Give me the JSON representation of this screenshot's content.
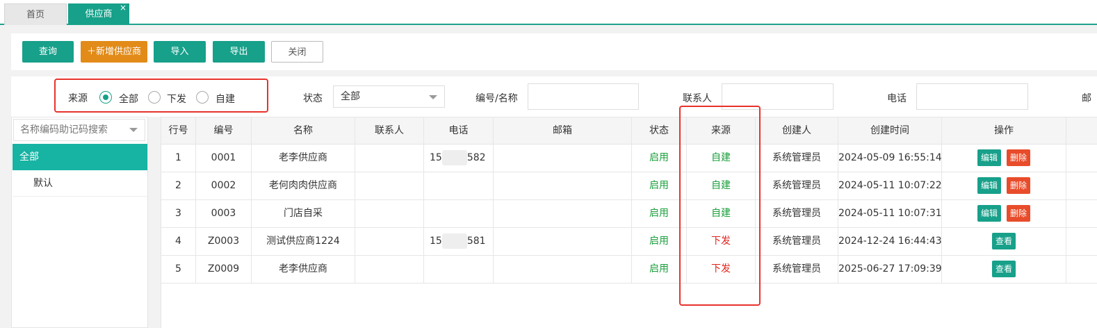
{
  "tabs": [
    {
      "label": "首页"
    },
    {
      "label": "供应商",
      "close": "×"
    }
  ],
  "toolbar": {
    "query": "查询",
    "add": "＋新增供应商",
    "import": "导入",
    "export": "导出",
    "close": "关闭"
  },
  "filters": {
    "source_label": "来源",
    "source_options": [
      "全部",
      "下发",
      "自建"
    ],
    "status_label": "状态",
    "status_value": "全部",
    "code_label": "编号/名称",
    "contact_label": "联系人",
    "phone_label": "电话",
    "email_label_partial": "邮"
  },
  "tree": {
    "search_placeholder": "名称编码助记码搜索",
    "items": [
      "全部",
      "默认"
    ]
  },
  "table": {
    "headers": [
      "行号",
      "编号",
      "名称",
      "联系人",
      "电话",
      "邮箱",
      "状态",
      "来源",
      "创建人",
      "创建时间",
      "操作"
    ],
    "rows": [
      {
        "no": "1",
        "code": "0001",
        "name": "老李供应商",
        "contact": "",
        "phone_a": "15",
        "phone_b": "582",
        "email": "",
        "status": "启用",
        "source": "自建",
        "creator": "系统管理员",
        "created": "2024-05-09 16:55:14",
        "actions": [
          "编辑",
          "删除"
        ]
      },
      {
        "no": "2",
        "code": "0002",
        "name": "老何肉肉供应商",
        "contact": "",
        "phone_a": "",
        "phone_b": "",
        "email": "",
        "status": "启用",
        "source": "自建",
        "creator": "系统管理员",
        "created": "2024-05-11 10:07:22",
        "actions": [
          "编辑",
          "删除"
        ]
      },
      {
        "no": "3",
        "code": "0003",
        "name": "门店自采",
        "contact": "",
        "phone_a": "",
        "phone_b": "",
        "email": "",
        "status": "启用",
        "source": "自建",
        "creator": "系统管理员",
        "created": "2024-05-11 10:07:31",
        "actions": [
          "编辑",
          "删除"
        ]
      },
      {
        "no": "4",
        "code": "Z0003",
        "name": "测试供应商1224",
        "contact": "",
        "phone_a": "15",
        "phone_b": "581",
        "email": "",
        "status": "启用",
        "source": "下发",
        "creator": "系统管理员",
        "created": "2024-12-24 16:44:43",
        "actions": [
          "查看"
        ]
      },
      {
        "no": "5",
        "code": "Z0009",
        "name": "老李供应商",
        "contact": "",
        "phone_a": "",
        "phone_b": "",
        "email": "",
        "status": "启用",
        "source": "下发",
        "creator": "系统管理员",
        "created": "2025-06-27 17:09:39",
        "actions": [
          "查看"
        ]
      }
    ]
  },
  "colors": {
    "accent": "#17a08a",
    "tree_selected": "#17b3a3",
    "orange_button": "#e28b19",
    "status_green": "#1b9f3c",
    "source_red": "#e0221b",
    "delete_button": "#e84c2b",
    "highlight_box": "#e8322b"
  }
}
